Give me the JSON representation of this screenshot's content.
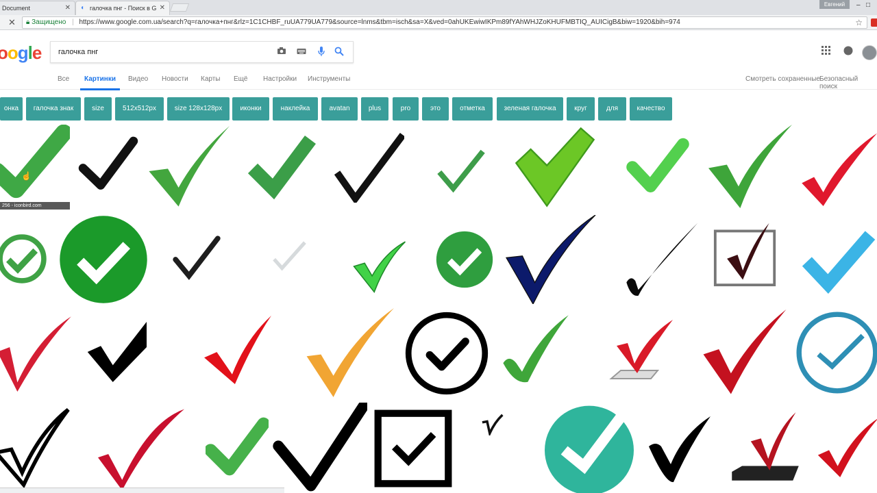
{
  "browser": {
    "tabs": [
      {
        "title": "Document",
        "active": false
      },
      {
        "title": "галочка пнг - Поиск в G",
        "active": true
      }
    ],
    "user_name": "Евгений",
    "secure_label": "Защищено",
    "url": "https://www.google.com.ua/search?q=галочка+пнг&rlz=1C1CHBF_ruUA779UA779&source=lnms&tbm=isch&sa=X&ved=0ahUKEwiwIKPm89fYAhWHJZoKHUFMBTIQ_AUICigB&biw=1920&bih=974"
  },
  "google": {
    "logo_text": "oogle",
    "query": "галочка пнг",
    "nav_tabs": [
      "Все",
      "Картинки",
      "Видео",
      "Новости",
      "Карты",
      "Ещё",
      "Настройки",
      "Инструменты"
    ],
    "nav_right": [
      "Смотреть сохраненные",
      "Безопасный поиск"
    ],
    "chips": [
      "онка",
      "галочка знак",
      "size",
      "512x512px",
      "size 128x128px",
      "иконки",
      "наклейка",
      "avatan",
      "plus",
      "pro",
      "это",
      "отметка",
      "зеленая галочка",
      "круг",
      "для",
      "качество"
    ],
    "hover_label": "256 - iconbird.com"
  },
  "colors": {
    "chip_bg": "#3a9e9a",
    "google_blue": "#4285f4",
    "active_tab_blue": "#1a73e8"
  },
  "icons": [
    "camera-icon",
    "keyboard-icon",
    "microphone-icon",
    "search-icon",
    "apps-grid-icon",
    "notifications-icon",
    "reload-icon",
    "lock-icon",
    "star-icon"
  ]
}
